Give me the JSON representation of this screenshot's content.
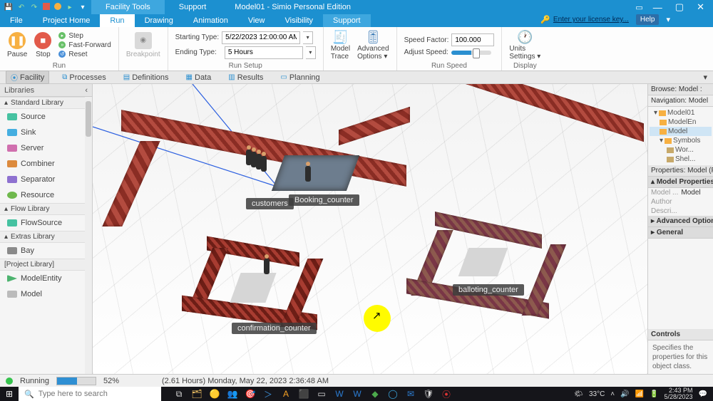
{
  "titlebar": {
    "tab1": "Facility Tools",
    "tab2": "Support",
    "appTitle": "Model01 - Simio Personal Edition",
    "license": "Enter your license key...",
    "help": "Help"
  },
  "menu": {
    "file": "File",
    "projectHome": "Project Home",
    "run": "Run",
    "drawing": "Drawing",
    "animation": "Animation",
    "view": "View",
    "visibility": "Visibility",
    "support": "Support"
  },
  "ribbon": {
    "pause": "Pause",
    "stop": "Stop",
    "step": "Step",
    "fastForward": "Fast-Forward",
    "reset": "Reset",
    "runGroup": "Run",
    "breakpoint": "Breakpoint",
    "startingTypeLabel": "Starting Type:",
    "startingTypeValue": "5/22/2023 12:00:00 AM",
    "endingTypeLabel": "Ending Type:",
    "endingTypeValue": "5 Hours",
    "runSetupGroup": "Run Setup",
    "modelTrace": "Model\nTrace",
    "advancedOptions": "Advanced\nOptions ▾",
    "speedFactorLabel": "Speed Factor:",
    "speedFactorValue": "100.000",
    "adjustSpeed": "Adjust Speed:",
    "runSpeedGroup": "Run Speed",
    "unitsSettings": "Units\nSettings ▾",
    "displayGroup": "Display"
  },
  "viewtabs": {
    "facility": "Facility",
    "processes": "Processes",
    "definitions": "Definitions",
    "data": "Data",
    "results": "Results",
    "planning": "Planning"
  },
  "libraries": {
    "title": "Libraries",
    "standard": "Standard Library",
    "items": [
      "Source",
      "Sink",
      "Server",
      "Combiner",
      "Separator",
      "Resource"
    ],
    "flow": "Flow Library",
    "flowItems": [
      "FlowSource"
    ],
    "extras": "Extras Library",
    "extrasItems": [
      "Bay"
    ],
    "project": "[Project Library]",
    "projectItems": [
      "ModelEntity",
      "Model"
    ]
  },
  "canvas": {
    "labels": {
      "customers": "customers",
      "booking": "Booking_counter",
      "confirmation": "confirmation_counter",
      "balloting": "balloting_counter"
    }
  },
  "rightPanel": {
    "browse": "Browse: Model :",
    "navigation": "Navigation: Model",
    "tree": {
      "model01": "Model01",
      "modelEn": "ModelEn",
      "model": "Model",
      "symbols": "Symbols",
      "wor": "Wor...",
      "shel": "Shel..."
    },
    "propsHeader": "Properties: Model (Fixe",
    "modelProps": "Model Properties",
    "modelLabel": "Model ...",
    "modelVal": "Model",
    "author": "Author",
    "descr": "Descri...",
    "advanced": "Advanced Options",
    "general": "General",
    "controls": "Controls",
    "controlsHelp": "Specifies the properties for this object class."
  },
  "status": {
    "running": "Running",
    "pct": "52%",
    "time": "(2.61 Hours) Monday, May 22, 2023 2:36:48 AM"
  },
  "taskbar": {
    "searchPlaceholder": "Type here to search",
    "temp": "33°C",
    "time": "2:43 PM",
    "date": "5/28/2023"
  }
}
